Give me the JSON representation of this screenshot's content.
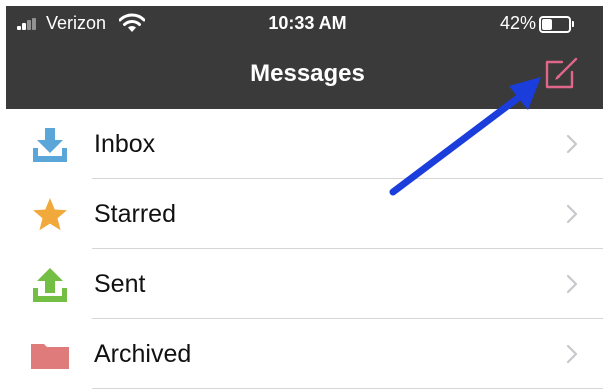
{
  "status_bar": {
    "carrier": "Verizon",
    "time": "10:33 AM",
    "battery_percent_label": "42%",
    "battery_level": 0.42
  },
  "header": {
    "title": "Messages",
    "compose_icon": "compose-icon",
    "compose_color": "#e0668a"
  },
  "folders": [
    {
      "label": "Inbox",
      "icon": "inbox-download-icon",
      "color": "#5aa6d9"
    },
    {
      "label": "Starred",
      "icon": "star-icon",
      "color": "#f2a93b"
    },
    {
      "label": "Sent",
      "icon": "sent-upload-icon",
      "color": "#72bf44"
    },
    {
      "label": "Archived",
      "icon": "folder-icon",
      "color": "#e07b7b"
    }
  ],
  "annotation": {
    "arrow_color": "#1a3ddb"
  },
  "colors": {
    "header_bg": "#3a3a3a",
    "separator": "#d6d6d6",
    "chevron": "#c7c7cc"
  }
}
